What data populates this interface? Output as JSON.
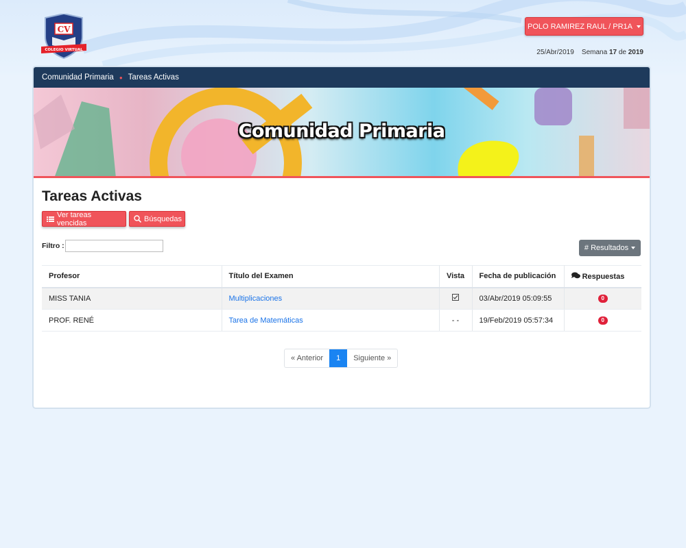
{
  "header": {
    "logo": {
      "text_top": "CV",
      "ribbon": "COLEGIO VIRTUAL"
    },
    "user_button": "POLO RAMIREZ RAUL / PR1A",
    "date": "25/Abr/2019",
    "week_label": "Semana",
    "week_number": "17",
    "week_of": "de",
    "year": "2019"
  },
  "breadcrumb": {
    "items": [
      "Comunidad Primaria",
      "Tareas Activas"
    ]
  },
  "banner": {
    "title": "Comunidad Primaria"
  },
  "main": {
    "title": "Tareas Activas",
    "buttons": {
      "expired": "Ver tareas vencidas",
      "search": "Búsquedas"
    },
    "filter": {
      "label": "Filtro :",
      "value": "",
      "placeholder": ""
    },
    "results_button": "# Resultados"
  },
  "table": {
    "headers": [
      "Profesor",
      "Título del Examen",
      "Vista",
      "Fecha de publicación",
      "Respuestas"
    ],
    "rows": [
      {
        "profesor": "MISS TANIA",
        "titulo": "Multiplicaciones",
        "vista": "checked",
        "fecha": "03/Abr/2019 05:09:55",
        "respuestas": "0"
      },
      {
        "profesor": "PROF. RENÉ",
        "titulo": "Tarea de Matemáticas",
        "vista": "- -",
        "fecha": "19/Feb/2019 05:57:34",
        "respuestas": "0"
      }
    ]
  },
  "pagination": {
    "prev": "« Anterior",
    "current": "1",
    "next": "Siguiente »"
  },
  "colors": {
    "accent": "#f0545a",
    "navy": "#1e3a5c",
    "link": "#1a73e8",
    "badge": "#e0213a",
    "page_active": "#1a84f2"
  },
  "icons": [
    "list-icon",
    "search-icon",
    "comments-icon",
    "checkbox-icon",
    "caret-down-icon"
  ]
}
